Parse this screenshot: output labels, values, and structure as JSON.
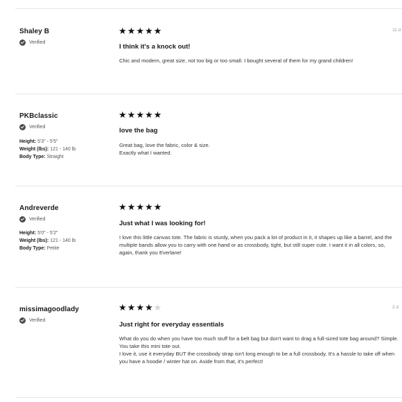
{
  "reviews": [
    {
      "name": "Shaley B",
      "verified": "Verified",
      "attributes": [],
      "rating": 5,
      "title": "I think it's a knock out!",
      "body": "Chic and modern, great size, not too big or too small. I bought several of them for my grand children!",
      "date": "11 d"
    },
    {
      "name": "PKBclassic",
      "verified": "Verified",
      "attributes": [
        {
          "label": "Height:",
          "value": "5'3\" - 5'5\""
        },
        {
          "label": "Weight (lbs):",
          "value": "121 - 140 lb"
        },
        {
          "label": "Body Type:",
          "value": "Straight"
        }
      ],
      "rating": 5,
      "title": "love the bag",
      "body": "Great bag, love the fabric, color & size.\nExactly what I wanted.",
      "date": ""
    },
    {
      "name": "Andreverde",
      "verified": "Verified",
      "attributes": [
        {
          "label": "Height:",
          "value": "5'0\" - 5'2\""
        },
        {
          "label": "Weight (lbs):",
          "value": "121 - 140 lb"
        },
        {
          "label": "Body Type:",
          "value": "Petite"
        }
      ],
      "rating": 5,
      "title": "Just what I was looking for!",
      "body": "I love this little canvas tote. The fabric is sturdy, when you pack a lot of product in it, it shapes up like a barrel, and the multiple bands allow you to carry with one hand or as crossbody, tight, but still super cute. I want it in all colors, so, again, thank you Everlane!",
      "date": ""
    },
    {
      "name": "missimagoodlady",
      "verified": "Verified",
      "attributes": [],
      "rating": 4,
      "title": "Just right for everyday essentials",
      "body": "What do you do when you have too much stuff for a belt bag but don't want to drag a full-sized tote bag around? Simple. You take this mini tote out.\nI love it, use it everyday BUT the crossbody strap isn't long enough to be a full crossbody. It's a hassle to take off when you have a hoodie / winter hat on. Aside from that, it's perfect!",
      "date": "2 d"
    }
  ]
}
